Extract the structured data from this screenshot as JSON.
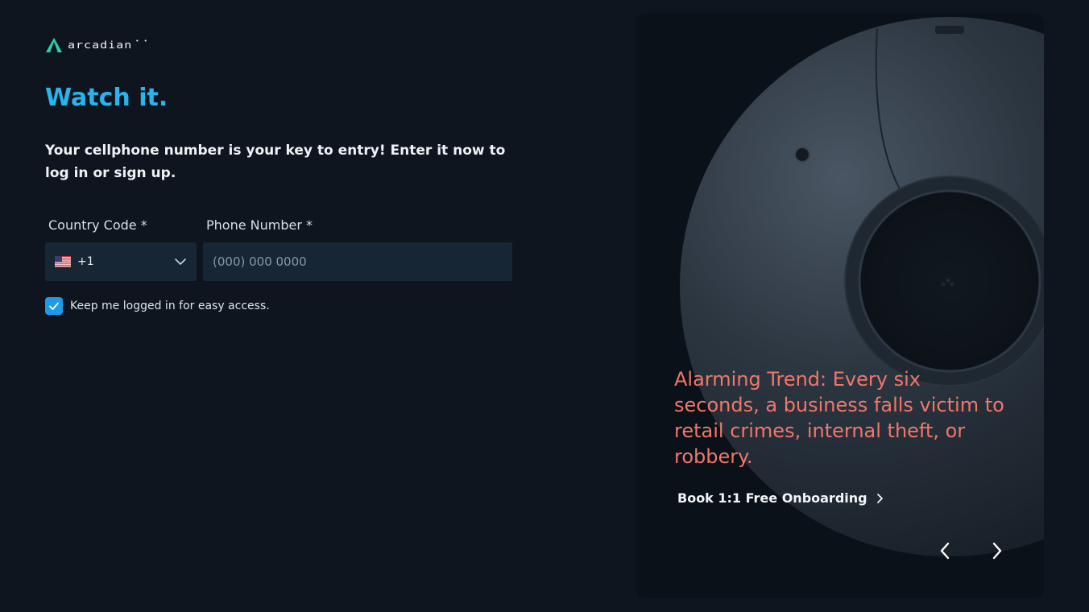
{
  "brand": {
    "name": "arcadian",
    "suffix": "• •",
    "accent": "#2bb3ec"
  },
  "heading": "Watch it.",
  "intro": "Your cellphone number is your key to entry! Enter it now to log in or sign up.",
  "form": {
    "country_code_label": "Country Code *",
    "country_code_value": "+1",
    "country_flag": "us-flag-icon",
    "phone_label": "Phone Number *",
    "phone_placeholder": "(000) 000 0000",
    "phone_value": "",
    "keep_logged_in_label": "Keep me logged in for easy access.",
    "keep_logged_in_checked": true
  },
  "promo": {
    "text": "Alarming Trend: Every six seconds, a business falls victim to retail crimes, internal theft, or robbery.",
    "cta_label": "Book 1:1 Free Onboarding",
    "text_color": "#f0776a",
    "prev_icon": "chevron-left-icon",
    "next_icon": "chevron-right-icon"
  }
}
